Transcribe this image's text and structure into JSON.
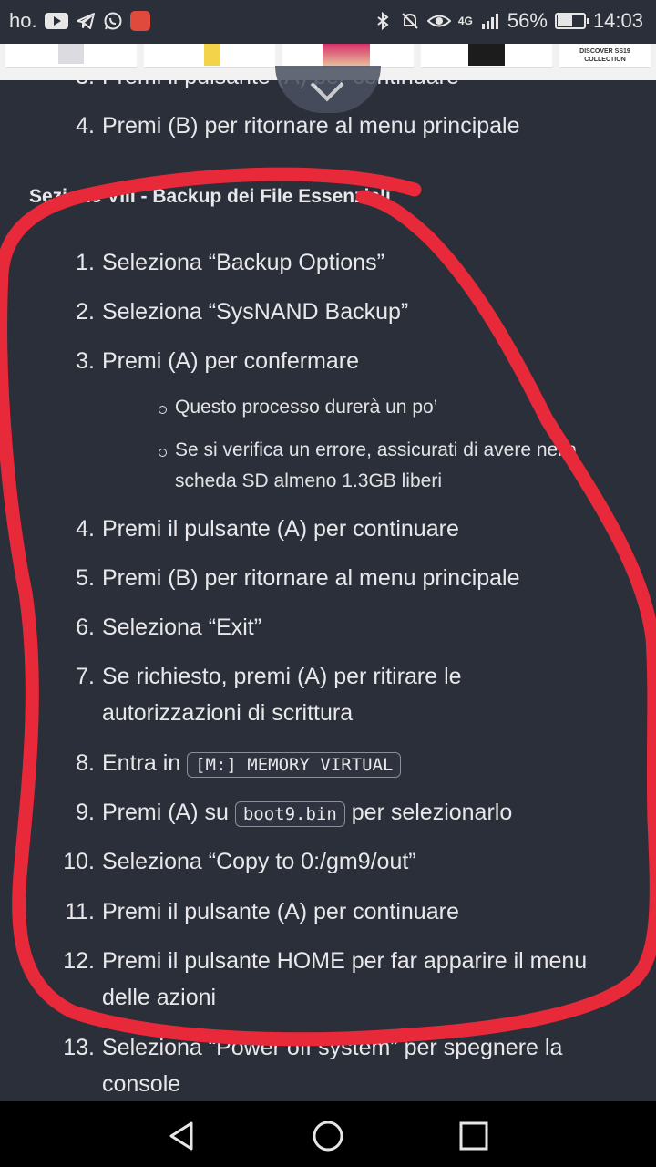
{
  "status_bar": {
    "carrier": "ho.",
    "battery_percent": "56%",
    "battery_level": 0.56,
    "time": "14:03",
    "network": "4G",
    "icons_left": [
      "youtube-icon",
      "telegram-icon",
      "whatsapp-icon",
      "app-icon"
    ],
    "icons_right": [
      "bluetooth-icon",
      "mute-icon",
      "eye-icon",
      "signal-icon",
      "battery-icon"
    ]
  },
  "ad": {
    "text": "DISCOVER SS19 COLLECTION"
  },
  "content": {
    "prev_item_partial": "Premi il pulsante (A) per continuare",
    "prev_item_4": {
      "num": "4.",
      "text": "Premi (B) per ritornare al menu principale"
    },
    "section_title": "Sezione VIII - Backup dei File Essenziali",
    "steps": [
      {
        "num": "1.",
        "text": "Seleziona “Backup Options”"
      },
      {
        "num": "2.",
        "text": "Seleziona “SysNAND Backup”"
      },
      {
        "num": "3.",
        "text": "Premi (A) per confermare"
      },
      {
        "num": "4.",
        "text": "Premi il pulsante (A) per continuare"
      },
      {
        "num": "5.",
        "text": "Premi (B) per ritornare al menu principale"
      },
      {
        "num": "6.",
        "text": "Seleziona “Exit”"
      },
      {
        "num": "7.",
        "text": "Se richiesto, premi (A) per ritirare le autorizzazioni di scrittura"
      },
      {
        "num": "8.",
        "pre": "Entra in ",
        "code": "[M:] MEMORY VIRTUAL"
      },
      {
        "num": "9.",
        "pre": "Premi (A) su ",
        "code": "boot9.bin",
        "post": " per selezionarlo"
      },
      {
        "num": "10.",
        "text": "Seleziona “Copy to 0:/gm9/out”"
      },
      {
        "num": "11.",
        "text": "Premi il pulsante (A) per continuare"
      },
      {
        "num": "12.",
        "text": "Premi il pulsante HOME per far apparire il menu delle azioni"
      },
      {
        "num": "13.",
        "text": "Seleziona “Power off system” per spegnere la console"
      }
    ],
    "sub_steps": [
      "Questo processo durerà un po’",
      "Se si verifica un errore, assicurati di avere nella scheda SD almeno 1.3GB liberi"
    ]
  },
  "annotation": {
    "color": "#e8293a"
  },
  "nav": {
    "icons": [
      "back-icon",
      "home-icon",
      "recents-icon"
    ]
  }
}
